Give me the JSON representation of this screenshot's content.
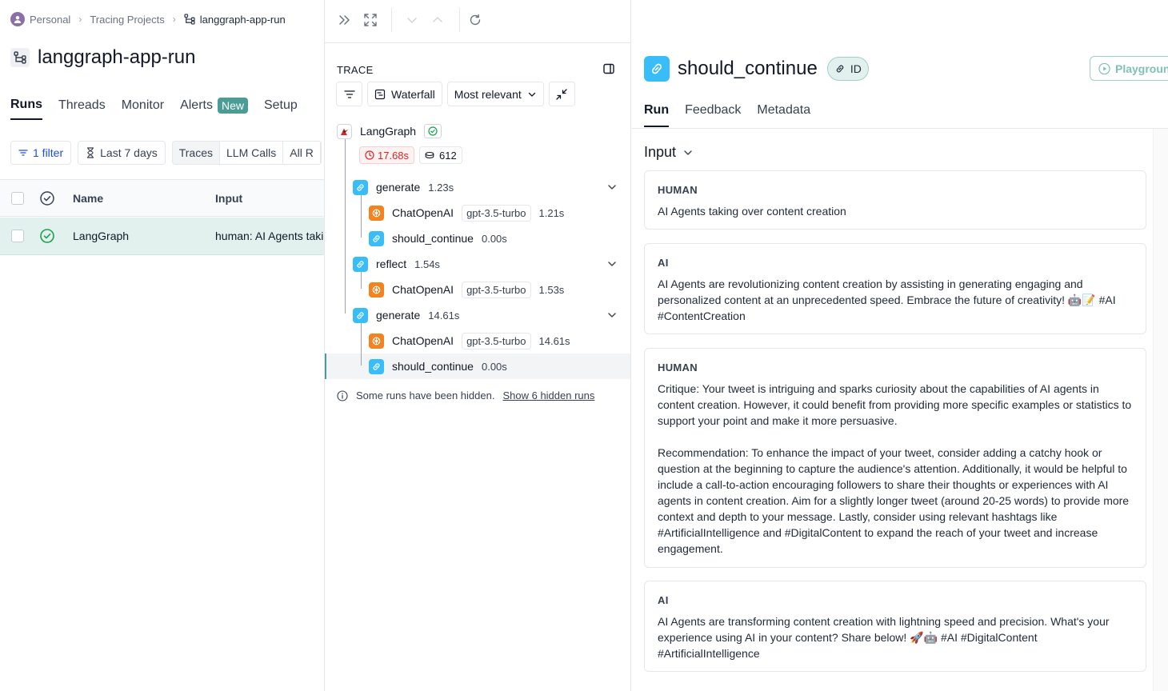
{
  "breadcrumb": {
    "workspace": "Personal",
    "section": "Tracing Projects",
    "current": "langgraph-app-run"
  },
  "project": {
    "title": "langgraph-app-run"
  },
  "left_tabs": [
    {
      "label": "Runs",
      "active": true
    },
    {
      "label": "Threads"
    },
    {
      "label": "Monitor"
    },
    {
      "label": "Alerts",
      "badge": "New"
    },
    {
      "label": "Setup"
    }
  ],
  "filters": {
    "filter_count": "1 filter",
    "time_range": "Last 7 days",
    "type_options": [
      "Traces",
      "LLM Calls",
      "All R"
    ]
  },
  "table": {
    "headers": {
      "name": "Name",
      "input": "Input"
    },
    "rows": [
      {
        "name": "LangGraph",
        "input": "human: AI Agents taking over content creation",
        "status": "success"
      }
    ]
  },
  "trace": {
    "label": "TRACE",
    "view_mode": "Waterfall",
    "sort": "Most relevant",
    "root": {
      "name": "LangGraph",
      "latency": "17.68s",
      "tokens": "612"
    },
    "nodes": [
      {
        "name": "generate",
        "duration": "1.23s"
      },
      {
        "name": "ChatOpenAI",
        "model": "gpt-3.5-turbo",
        "duration": "1.21s"
      },
      {
        "name": "should_continue",
        "duration": "0.00s"
      },
      {
        "name": "reflect",
        "duration": "1.54s"
      },
      {
        "name": "ChatOpenAI",
        "model": "gpt-3.5-turbo",
        "duration": "1.53s"
      },
      {
        "name": "generate",
        "duration": "14.61s"
      },
      {
        "name": "ChatOpenAI",
        "model": "gpt-3.5-turbo",
        "duration": "14.61s"
      },
      {
        "name": "should_continue",
        "duration": "0.00s"
      }
    ],
    "hidden_note": "Some runs have been hidden.",
    "hidden_link": "Show 6 hidden runs"
  },
  "run": {
    "name": "should_continue",
    "id_label": "ID",
    "playground_label": "Playground",
    "tabs": [
      "Run",
      "Feedback",
      "Metadata"
    ],
    "input_label": "Input",
    "messages": [
      {
        "role": "HUMAN",
        "text": "AI Agents taking over content creation"
      },
      {
        "role": "AI",
        "text": "AI Agents are revolutionizing content creation by assisting in generating engaging and personalized content at an unprecedented speed. Embrace the future of creativity! 🤖📝 #AI #ContentCreation"
      },
      {
        "role": "HUMAN",
        "text": "Critique: Your tweet is intriguing and sparks curiosity about the capabilities of AI agents in content creation. However, it could benefit from providing more specific examples or statistics to support your point and make it more persuasive.\n\nRecommendation: To enhance the impact of your tweet, consider adding a catchy hook or question at the beginning to capture the audience's attention. Additionally, it would be helpful to include a call-to-action encouraging followers to share their thoughts or experiences with AI agents in content creation. Aim for a slightly longer tweet (around 20-25 words) to provide more context and depth to your message. Lastly, consider using relevant hashtags like #ArtificialIntelligence and #DigitalContent to expand the reach of your tweet and increase engagement."
      },
      {
        "role": "AI",
        "text": "AI Agents are transforming content creation with lightning speed and precision. What's your experience using AI in your content? Share below! 🚀🤖 #AI #DigitalContent #ArtificialIntelligence"
      }
    ]
  },
  "colors": {
    "accent_teal": "#4b9c94",
    "run_blue": "#38bdf8",
    "llm_orange": "#f5821f",
    "latency_red": "#dc2626"
  }
}
